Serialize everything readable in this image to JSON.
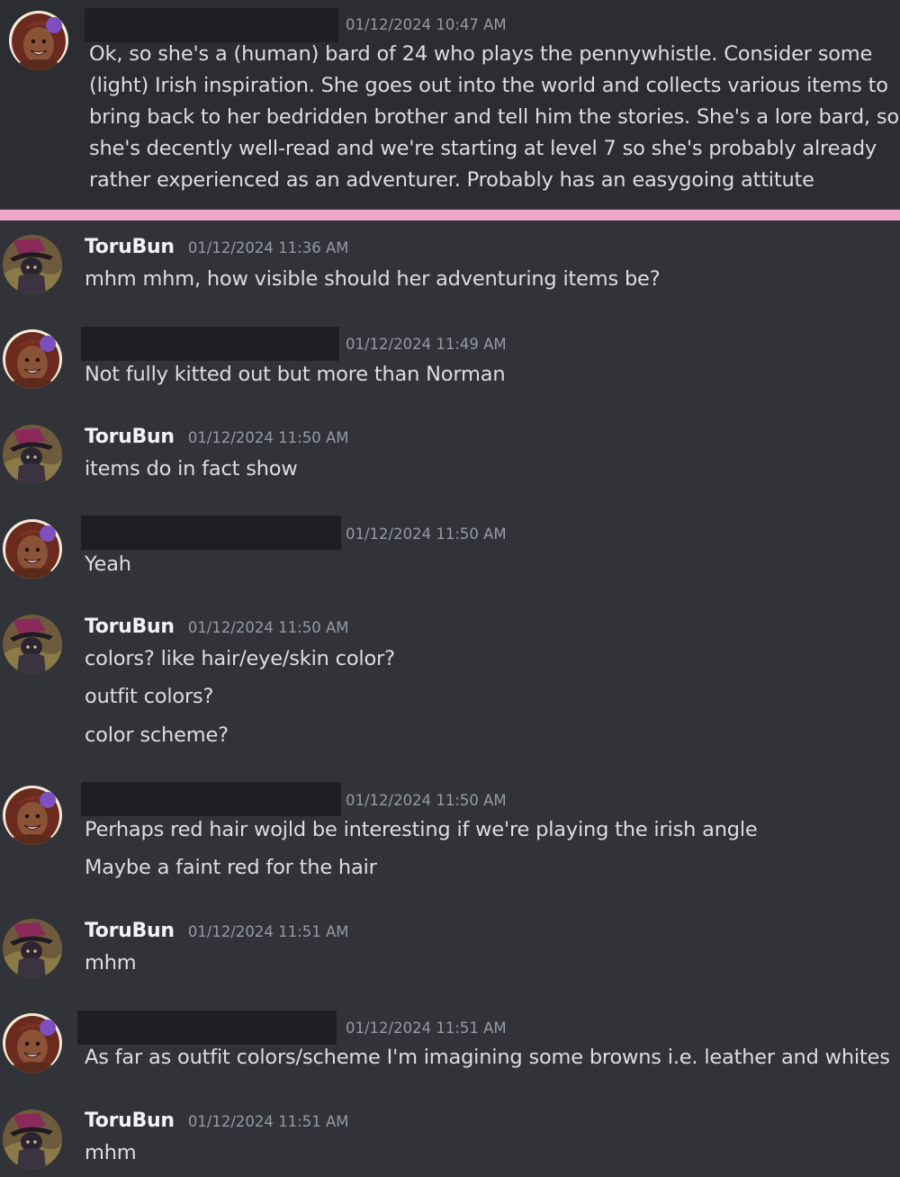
{
  "colors": {
    "background": "#313338",
    "highlight": "#2b2d31",
    "divider": "#f0a6c8",
    "username": "#f2f3f5",
    "timestamp": "#949ba4",
    "text": "#dbdee1",
    "redaction": "#1e1f22"
  },
  "messages": [
    {
      "author": "",
      "redacted": true,
      "timestamp": "01/12/2024 10:47 AM",
      "lines": [
        "Ok, so she's a (human) bard of 24 who plays the pennywhistle. Consider some",
        "(light) Irish inspiration. She goes out into the world and collects various items to",
        "bring back to her bedridden brother and tell him the stories. She's a lore bard, so",
        "she's decently well-read and we're starting at level 7 so she's probably already",
        "rather experienced as an adventurer. Probably has an easygoing attitute"
      ]
    },
    {
      "author": "ToruBun",
      "timestamp": "01/12/2024 11:36 AM",
      "lines": [
        "mhm mhm, how visible should her adventuring items be?"
      ]
    },
    {
      "author": "",
      "redacted": true,
      "timestamp": "01/12/2024 11:49 AM",
      "lines": [
        "Not fully kitted out but more than Norman"
      ]
    },
    {
      "author": "ToruBun",
      "timestamp": "01/12/2024 11:50 AM",
      "lines": [
        "items do in fact show"
      ]
    },
    {
      "author": "",
      "redacted": true,
      "timestamp": "01/12/2024 11:50 AM",
      "lines": [
        "Yeah"
      ]
    },
    {
      "author": "ToruBun",
      "timestamp": "01/12/2024 11:50 AM",
      "lines": [
        "colors? like hair/eye/skin color?",
        "outfit colors?",
        "color scheme?"
      ]
    },
    {
      "author": "",
      "redacted": true,
      "timestamp": "01/12/2024 11:50 AM",
      "lines": [
        "Perhaps red hair wojld be interesting if we're playing the irish angle",
        "Maybe a faint red for the hair"
      ]
    },
    {
      "author": "ToruBun",
      "timestamp": "01/12/2024 11:51 AM",
      "lines": [
        "mhm"
      ]
    },
    {
      "author": "",
      "redacted": true,
      "timestamp": "01/12/2024 11:51 AM",
      "lines": [
        "As far as outfit colors/scheme I'm imagining some browns i.e. leather and whites"
      ]
    },
    {
      "author": "ToruBun",
      "timestamp": "01/12/2024 11:51 AM",
      "lines": [
        "mhm"
      ]
    }
  ]
}
